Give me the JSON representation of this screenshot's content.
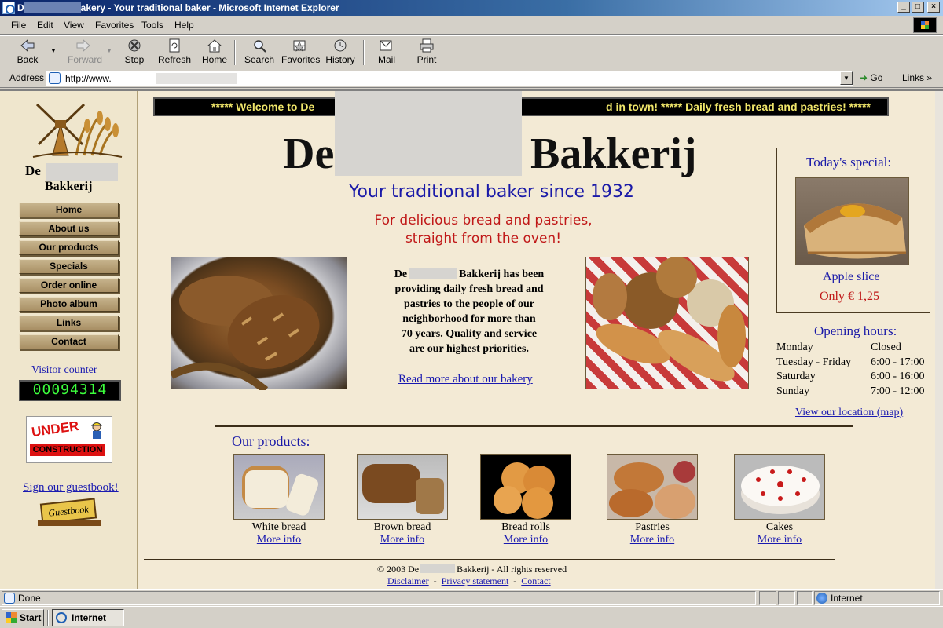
{
  "window": {
    "title_prefix": "D",
    "title_suffix": "akery - Your traditional baker - Microsoft Internet Explorer",
    "minimize_glyph": "_",
    "maximize_glyph": "□",
    "close_glyph": "×"
  },
  "menu": [
    "File",
    "Edit",
    "View",
    "Favorites",
    "Tools",
    "Help"
  ],
  "toolbar": {
    "back": "Back",
    "forward": "Forward",
    "stop": "Stop",
    "refresh": "Refresh",
    "home": "Home",
    "search": "Search",
    "favorites": "Favorites",
    "history": "History",
    "mail": "Mail",
    "print": "Print"
  },
  "address": {
    "label": "Address",
    "url": "http://www.",
    "go": "Go",
    "links": "Links"
  },
  "sidebar": {
    "name_line1": "De",
    "name_line2": "Bakkerij",
    "nav": [
      "Home",
      "About us",
      "Our products",
      "Specials",
      "Order online",
      "Photo album",
      "Links",
      "Contact"
    ],
    "visitor_label": "Visitor counter",
    "visitor_count": "00094314",
    "under_construction_top": "UNDER",
    "under_construction_bottom": "CONSTRUCTION",
    "guestbook_link": "Sign our guestbook!",
    "guestbook_sign": "Guestbook"
  },
  "marquee": {
    "left": "*****    Welcome to De",
    "right": "d in town!  *****    Daily fresh bread and pastries!    *****"
  },
  "header": {
    "title_left": "De",
    "title_right": "Bakkerij",
    "subtitle": "Your traditional baker since 1932",
    "tagline_line1": "For delicious bread and pastries,",
    "tagline_line2": "straight from the oven!"
  },
  "intro": {
    "line1_prefix": "De",
    "line1_suffix": "Bakkerij has been",
    "line2": "providing daily fresh bread and",
    "line3": "pastries to the people of our",
    "line4": "neighborhood for more than",
    "line5": "70 years. Quality and service",
    "line6": "are our highest priorities.",
    "read_more": "Read more about our bakery"
  },
  "special": {
    "title": "Today's special:",
    "name": "Apple slice",
    "price": "Only € 1,25"
  },
  "hours": {
    "title": "Opening hours:",
    "rows": [
      {
        "day": "Monday",
        "time": "Closed"
      },
      {
        "day": "Tuesday - Friday",
        "time": "6:00 - 17:00"
      },
      {
        "day": "Saturday",
        "time": "6:00 - 16:00"
      },
      {
        "day": "Sunday",
        "time": "7:00 - 12:00"
      }
    ],
    "map_link": "View our location (map)"
  },
  "products": {
    "title": "Our products:",
    "more_info": "More info",
    "items": [
      "White bread",
      "Brown bread",
      "Bread rolls",
      "Pastries",
      "Cakes"
    ]
  },
  "footer": {
    "copyright_prefix": "© 2003 De",
    "copyright_suffix": "Bakkerij - All rights reserved",
    "links": [
      "Disclaimer",
      "Privacy statement",
      "Contact"
    ],
    "separator": "-"
  },
  "status": {
    "text": "Done",
    "zone": "Internet"
  },
  "taskbar": {
    "start": "Start",
    "task": "Internet"
  }
}
